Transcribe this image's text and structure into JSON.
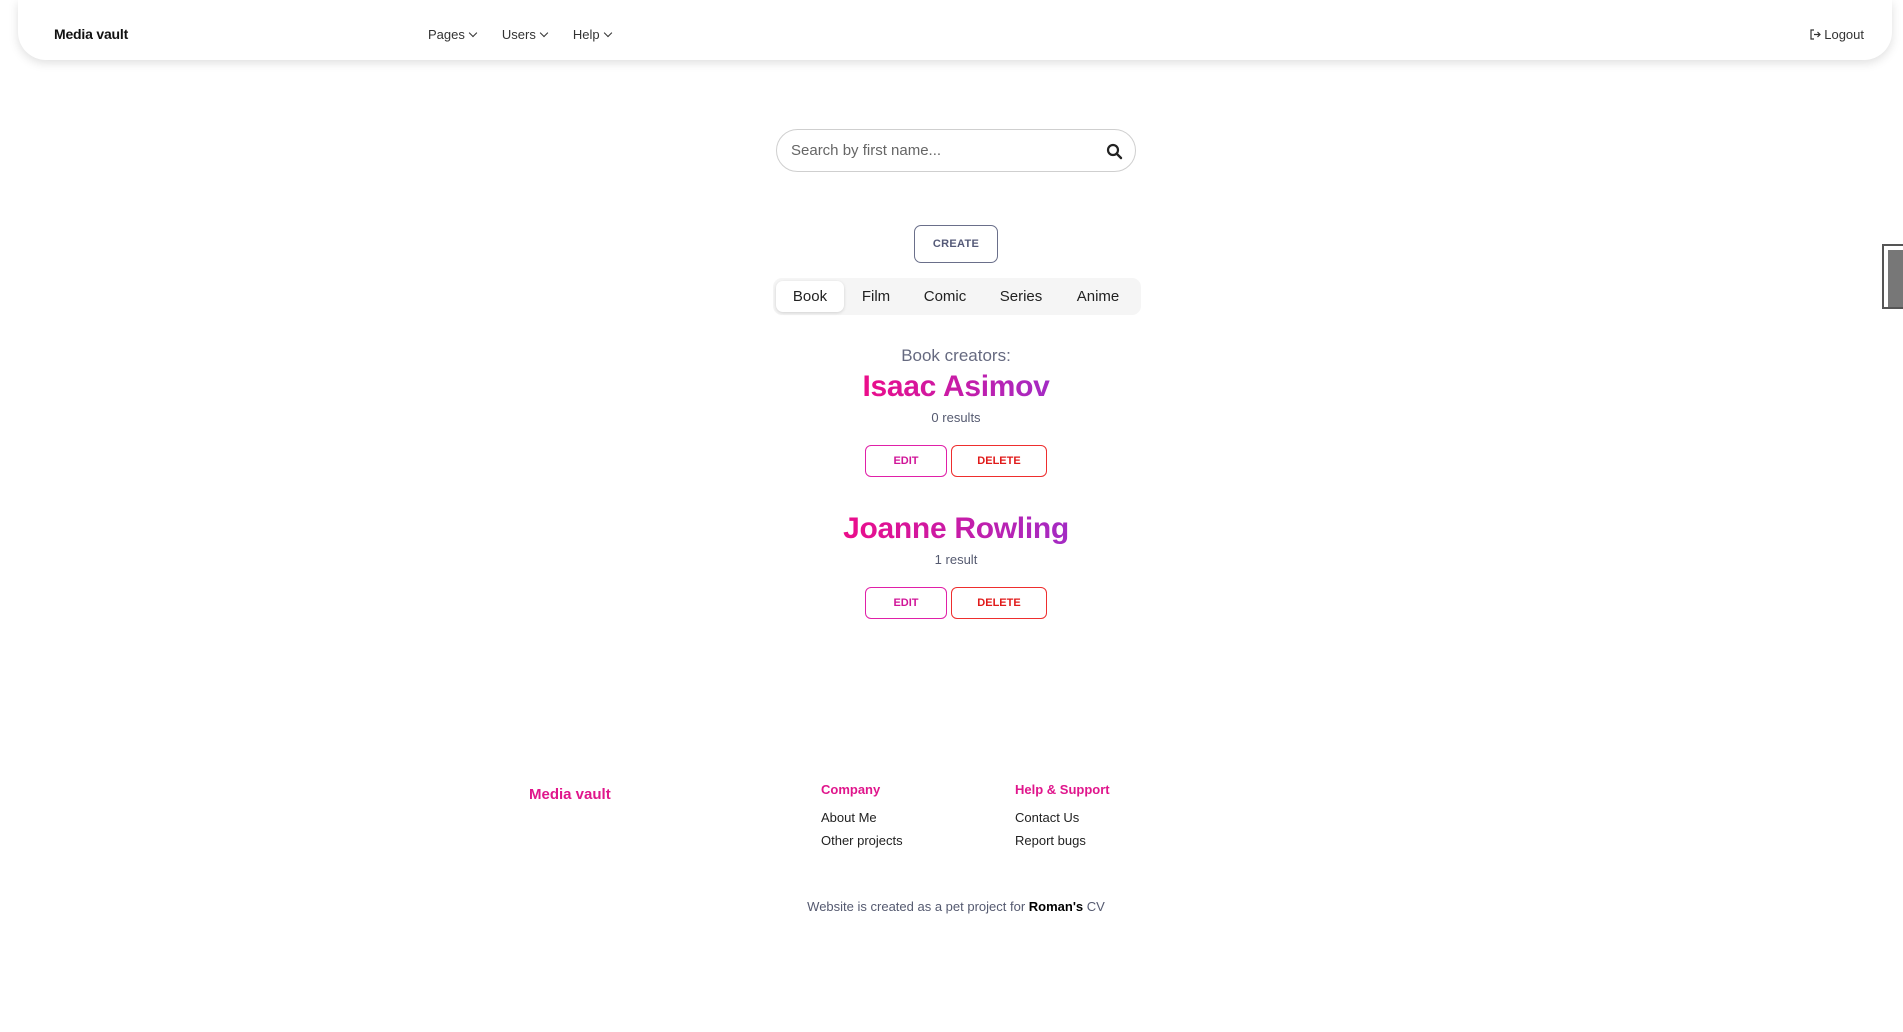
{
  "navbar": {
    "brand": "Media vault",
    "menu": [
      {
        "label": "Pages"
      },
      {
        "label": "Users"
      },
      {
        "label": "Help"
      }
    ],
    "logout_label": "Logout"
  },
  "search": {
    "placeholder": "Search by first name...",
    "value": ""
  },
  "create_label": "CREATE",
  "tabs": [
    {
      "label": "Book",
      "active": true
    },
    {
      "label": "Film",
      "active": false
    },
    {
      "label": "Comic",
      "active": false
    },
    {
      "label": "Series",
      "active": false
    },
    {
      "label": "Anime",
      "active": false
    }
  ],
  "section_title": "Book creators:",
  "creators": [
    {
      "name": "Isaac Asimov",
      "results": "0 results",
      "edit_label": "EDIT",
      "delete_label": "DELETE"
    },
    {
      "name": "Joanne Rowling",
      "results": "1 result",
      "edit_label": "EDIT",
      "delete_label": "DELETE"
    }
  ],
  "footer": {
    "brand": "Media vault",
    "company": {
      "heading": "Company",
      "links": [
        "About Me",
        "Other projects"
      ]
    },
    "support": {
      "heading": "Help & Support",
      "links": [
        "Contact Us",
        "Report bugs"
      ]
    },
    "note_prefix": "Website is created as a pet project for ",
    "note_name": "Roman's",
    "note_suffix": " CV"
  },
  "colors": {
    "accent_pink": "#e0168c",
    "accent_purple": "#a32bc4",
    "delete_red": "#e01a1a"
  }
}
